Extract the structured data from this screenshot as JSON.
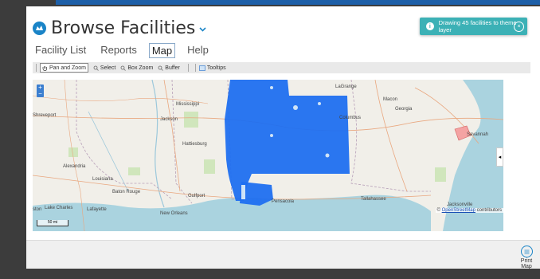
{
  "page": {
    "title": "Browse Facilities",
    "nav": [
      "Facility List",
      "Reports",
      "Map",
      "Help"
    ],
    "active_nav": "Map"
  },
  "toolbar": {
    "pan_label": "Pan and Zoom",
    "select_label": "Select",
    "box_zoom_label": "Box Zoom",
    "buffer_label": "Buffer",
    "tooltips_label": "Tooltips"
  },
  "map": {
    "zoom_in": "+",
    "zoom_out": "−",
    "labels": {
      "mississippi": "Mississippi",
      "jackson": "Jackson",
      "shreveport": "Shreveport",
      "macon": "Macon",
      "georgia": "Georgia",
      "columbus": "Columbus",
      "lagrange": "LaGrange",
      "alexandria": "Alexandria",
      "louisiana": "Louisiana",
      "hattiesburg": "Hattiesburg",
      "baton_rouge": "Baton Rouge",
      "lake_charles": "Lake Charles",
      "lafayette": "Lafayette",
      "new_orleans": "New Orleans",
      "gulfport": "Gulfport",
      "pensacola": "Pensacola",
      "tallahassee": "Tallahassee",
      "savannah": "Savannah",
      "jacksonville": "Jacksonville",
      "houston_left": "ston"
    },
    "scale_label": "50 mi",
    "attribution_prefix": "© ",
    "attribution_link": "OpenStreetMap",
    "attribution_suffix": " contributors",
    "panel_toggle": "◂",
    "facility_color": "#1f6ff0"
  },
  "footer": {
    "print_label": "Print Map"
  },
  "toast": {
    "message": "Drawing 45 facilities to theme layer"
  },
  "colors": {
    "accent": "#1a84c7",
    "toast": "#3cb1b6"
  }
}
